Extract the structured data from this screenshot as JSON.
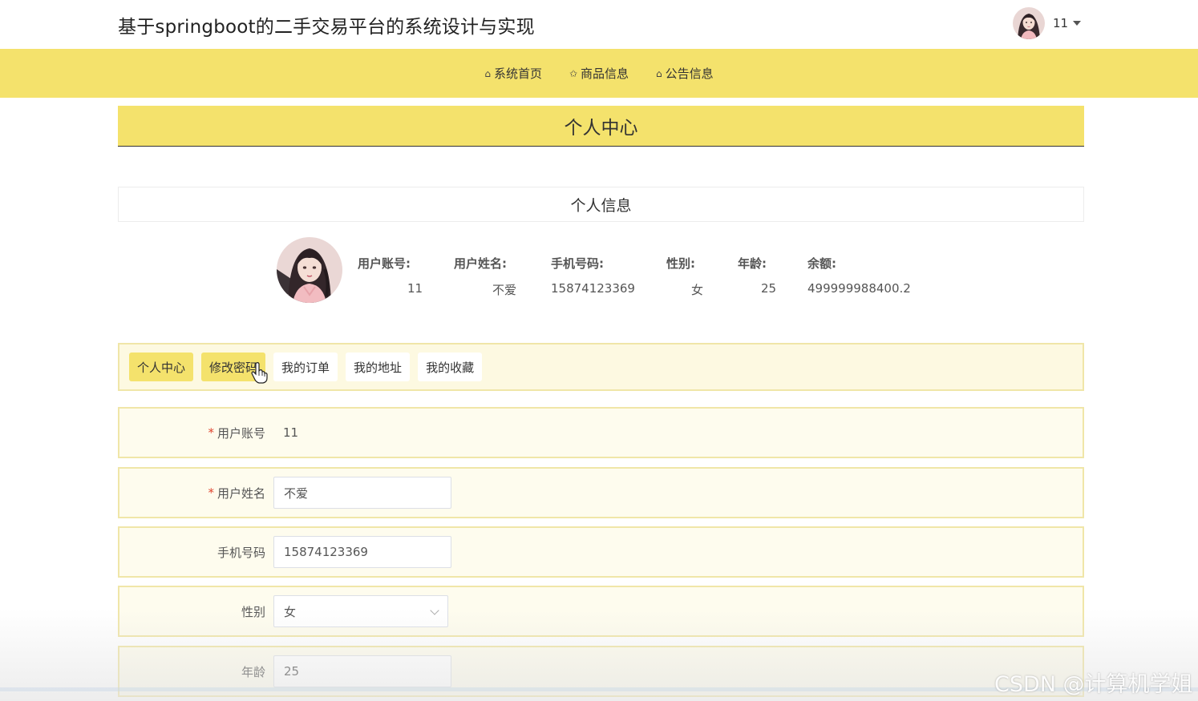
{
  "header": {
    "site_title": "基于springboot的二手交易平台的系统设计与实现",
    "user_name": "11"
  },
  "nav": {
    "items": [
      {
        "label": "系统首页",
        "icon": "home-icon",
        "glyph": "⌂"
      },
      {
        "label": "商品信息",
        "icon": "star-icon",
        "glyph": "✩"
      },
      {
        "label": "公告信息",
        "icon": "bag-icon",
        "glyph": "⌂"
      }
    ]
  },
  "section": {
    "title": "个人中心"
  },
  "info": {
    "card_title": "个人信息",
    "fields": [
      {
        "label": "用户账号:",
        "value": "11"
      },
      {
        "label": "用户姓名:",
        "value": "不爱"
      },
      {
        "label": "手机号码:",
        "value": "15874123369"
      },
      {
        "label": "性别:",
        "value": "女"
      },
      {
        "label": "年龄:",
        "value": "25"
      },
      {
        "label": "余额:",
        "value": "499999988400.2"
      }
    ]
  },
  "tabs": [
    {
      "label": "个人中心",
      "active": true
    },
    {
      "label": "修改密码",
      "active": true
    },
    {
      "label": "我的订单",
      "active": false
    },
    {
      "label": "我的地址",
      "active": false
    },
    {
      "label": "我的收藏",
      "active": false
    }
  ],
  "form": {
    "required_mark": "*",
    "account": {
      "label": "用户账号",
      "value": "11"
    },
    "name": {
      "label": "用户姓名",
      "value": "不爱"
    },
    "phone": {
      "label": "手机号码",
      "value": "15874123369"
    },
    "gender": {
      "label": "性别",
      "value": "女"
    },
    "age": {
      "label": "年龄",
      "value": "25"
    }
  },
  "watermark": "CSDN @计算机学姐",
  "colors": {
    "accent": "#f4e26c",
    "panel": "#fefcee",
    "required": "#e0452f"
  }
}
